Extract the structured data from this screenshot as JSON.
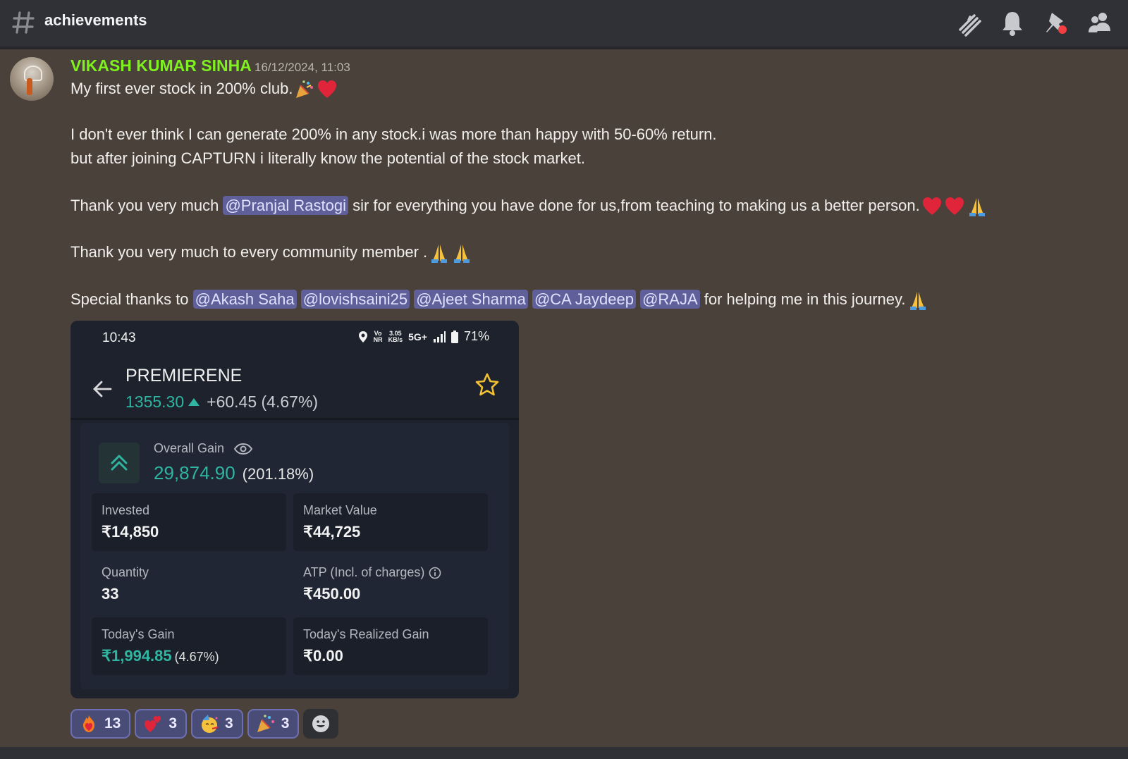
{
  "header": {
    "channel_name": "achievements",
    "icons": [
      "threads-icon",
      "bell-icon",
      "pin-icon",
      "members-icon"
    ]
  },
  "message": {
    "author": "VIKASH KUMAR SINHA",
    "author_color": "#7ef11f",
    "timestamp": "16/12/2024, 11:03",
    "line1": "My first ever stock in 200% club.",
    "line2": "I don't ever think I can generate 200% in any stock.i was more than happy with 50-60% return.",
    "line3": "but after joining CAPTURN i literally know the potential of the stock market.",
    "line4_before": "Thank you very much ",
    "line4_mention": "@Pranjal Rastogi",
    "line4_after": " sir for everything you have done for us,from teaching to making us a better person.",
    "line5": "Thank you very much to every community member  .",
    "line6_before": "Special thanks to ",
    "mentions": [
      "@Akash Saha",
      "@lovishsaini25",
      "@Ajeet Sharma",
      "@CA Jaydeep",
      "@RAJA"
    ],
    "line6_after": " for helping me in this journey."
  },
  "attachment": {
    "status_time": "10:43",
    "status_network": "5G+",
    "status_speed_top": "3.05",
    "status_speed_bottom": "KB/s",
    "status_volte_top": "Vo",
    "status_volte_bottom": "NR",
    "battery": "71%",
    "stock_name": "PREMIERENE",
    "price": "1355.30",
    "change": "+60.45 (4.67%)",
    "overall_gain_label": "Overall Gain",
    "overall_gain_value": "29,874.90",
    "overall_gain_pct": "(201.18%)",
    "invested_label": "Invested",
    "invested_value": "₹14,850",
    "market_value_label": "Market Value",
    "market_value_value": "₹44,725",
    "quantity_label": "Quantity",
    "quantity_value": "33",
    "atp_label": "ATP (Incl. of charges)",
    "atp_value": "₹450.00",
    "todays_gain_label": "Today's Gain",
    "todays_gain_value": "₹1,994.85",
    "todays_gain_pct": "(4.67%)",
    "realized_label": "Today's Realized Gain",
    "realized_value": "₹0.00"
  },
  "reactions": [
    {
      "emoji": "fire-heart",
      "count": "13"
    },
    {
      "emoji": "two-hearts",
      "count": "3"
    },
    {
      "emoji": "party-face",
      "count": "3"
    },
    {
      "emoji": "party-popper",
      "count": "3"
    }
  ]
}
